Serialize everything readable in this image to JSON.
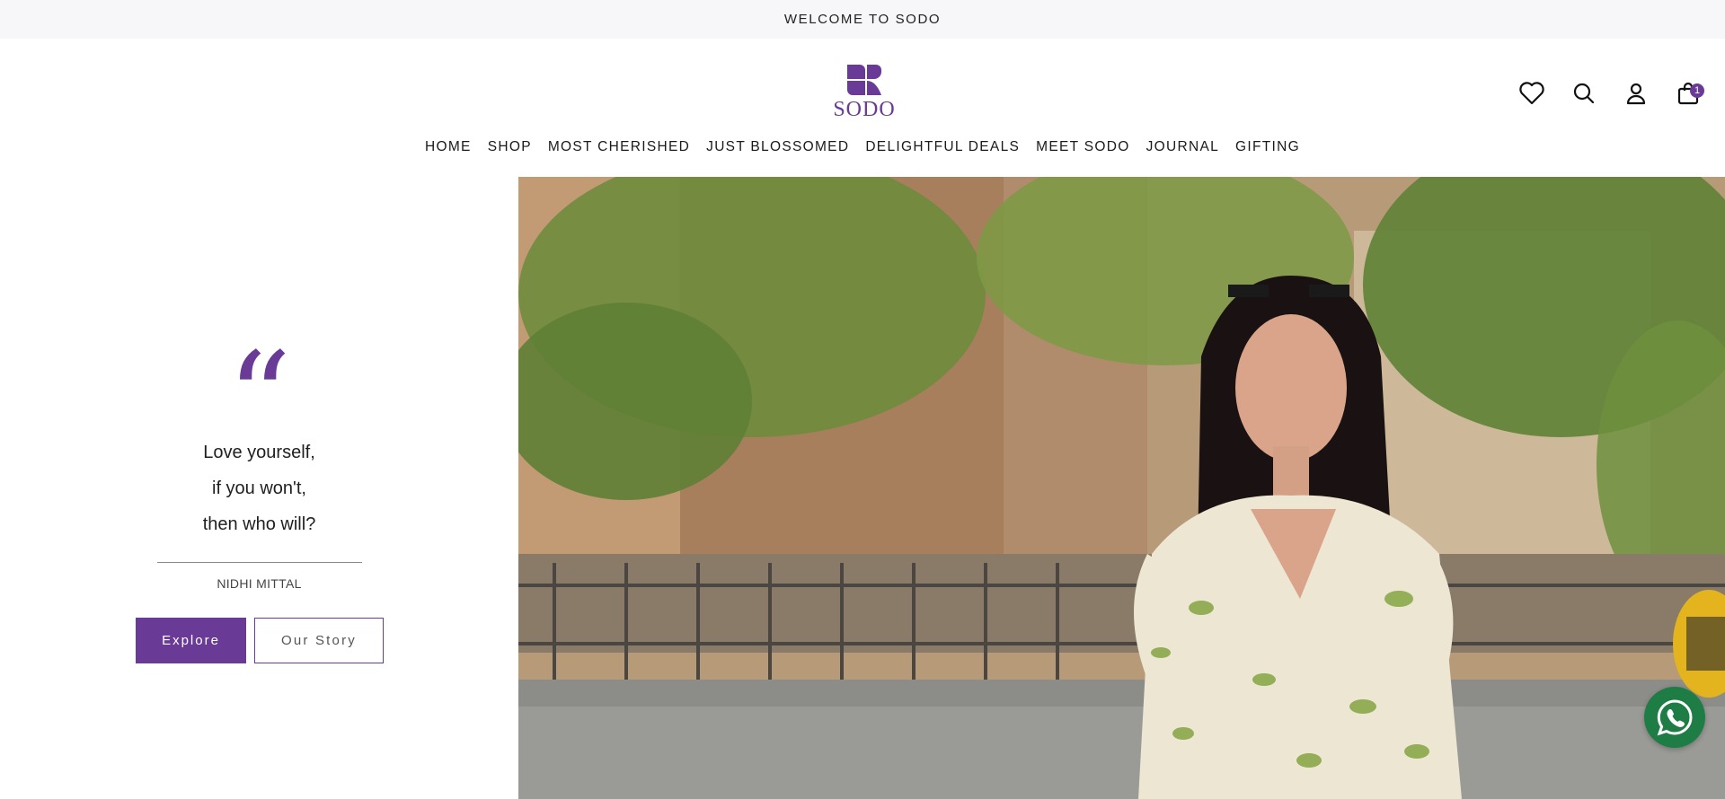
{
  "announcement": {
    "text": "WELCOME TO SODO"
  },
  "brand": {
    "name": "SODO",
    "color": "#6a3a97"
  },
  "header_icons": {
    "wishlist": "heart-icon",
    "search": "search-icon",
    "account": "user-icon",
    "cart": "shopping-bag-icon",
    "cart_count": "1"
  },
  "nav": {
    "items": [
      {
        "label": "HOME"
      },
      {
        "label": "SHOP"
      },
      {
        "label": "MOST CHERISHED"
      },
      {
        "label": "JUST BLOSSOMED"
      },
      {
        "label": "DELIGHTFUL DEALS"
      },
      {
        "label": "MEET SODO"
      },
      {
        "label": "JOURNAL"
      },
      {
        "label": "GIFTING"
      }
    ]
  },
  "hero": {
    "quote_mark": "“",
    "quote_lines": [
      "Love yourself,",
      "if you won't,",
      "then who will?"
    ],
    "author": "NIDHI MITTAL",
    "explore_label": "Explore",
    "story_label": "Our Story"
  },
  "floating": {
    "whatsapp": "whatsapp-icon",
    "whatsapp_color": "#1e7c45"
  }
}
